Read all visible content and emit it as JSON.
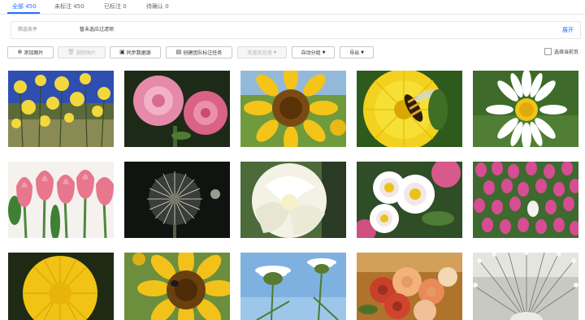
{
  "tabs": [
    {
      "label": "全部 450"
    },
    {
      "label": "未标注 450"
    },
    {
      "label": "已标注 0"
    },
    {
      "label": "待确认 0"
    }
  ],
  "filter": {
    "label": "筛选条件",
    "value": "暂未选应过滤项",
    "expand": "展开"
  },
  "toolbar": {
    "add_image": "添加图片",
    "delete_image": "删除图片",
    "sync_dataset": "同步数据源",
    "create_team_task": "创建团队标注任务",
    "batch_process": "批量批处理",
    "auto_group": "自动分组",
    "export": "导出",
    "select_current_page": "选择当前页"
  },
  "icons": {
    "add": "plus-circle-icon",
    "delete": "trash-icon",
    "sync": "sync-icon",
    "team": "team-icon",
    "dropdown": "chevron-down-icon"
  },
  "colors": {
    "accent": "#1e6fff"
  },
  "images": [
    {
      "name": "yellow-wildflowers-sky"
    },
    {
      "name": "pink-roses"
    },
    {
      "name": "sunflower"
    },
    {
      "name": "hoverfly-on-yellow-flower"
    },
    {
      "name": "white-daisy"
    },
    {
      "name": "pink-tulips"
    },
    {
      "name": "dandelion-seed-head"
    },
    {
      "name": "white-rose"
    },
    {
      "name": "white-wild-roses"
    },
    {
      "name": "pink-tulip-field"
    },
    {
      "name": "yellow-dandelion"
    },
    {
      "name": "sunflower-with-bee"
    },
    {
      "name": "daisies-against-sky"
    },
    {
      "name": "rose-bouquet"
    },
    {
      "name": "dandelion-close-up"
    }
  ]
}
